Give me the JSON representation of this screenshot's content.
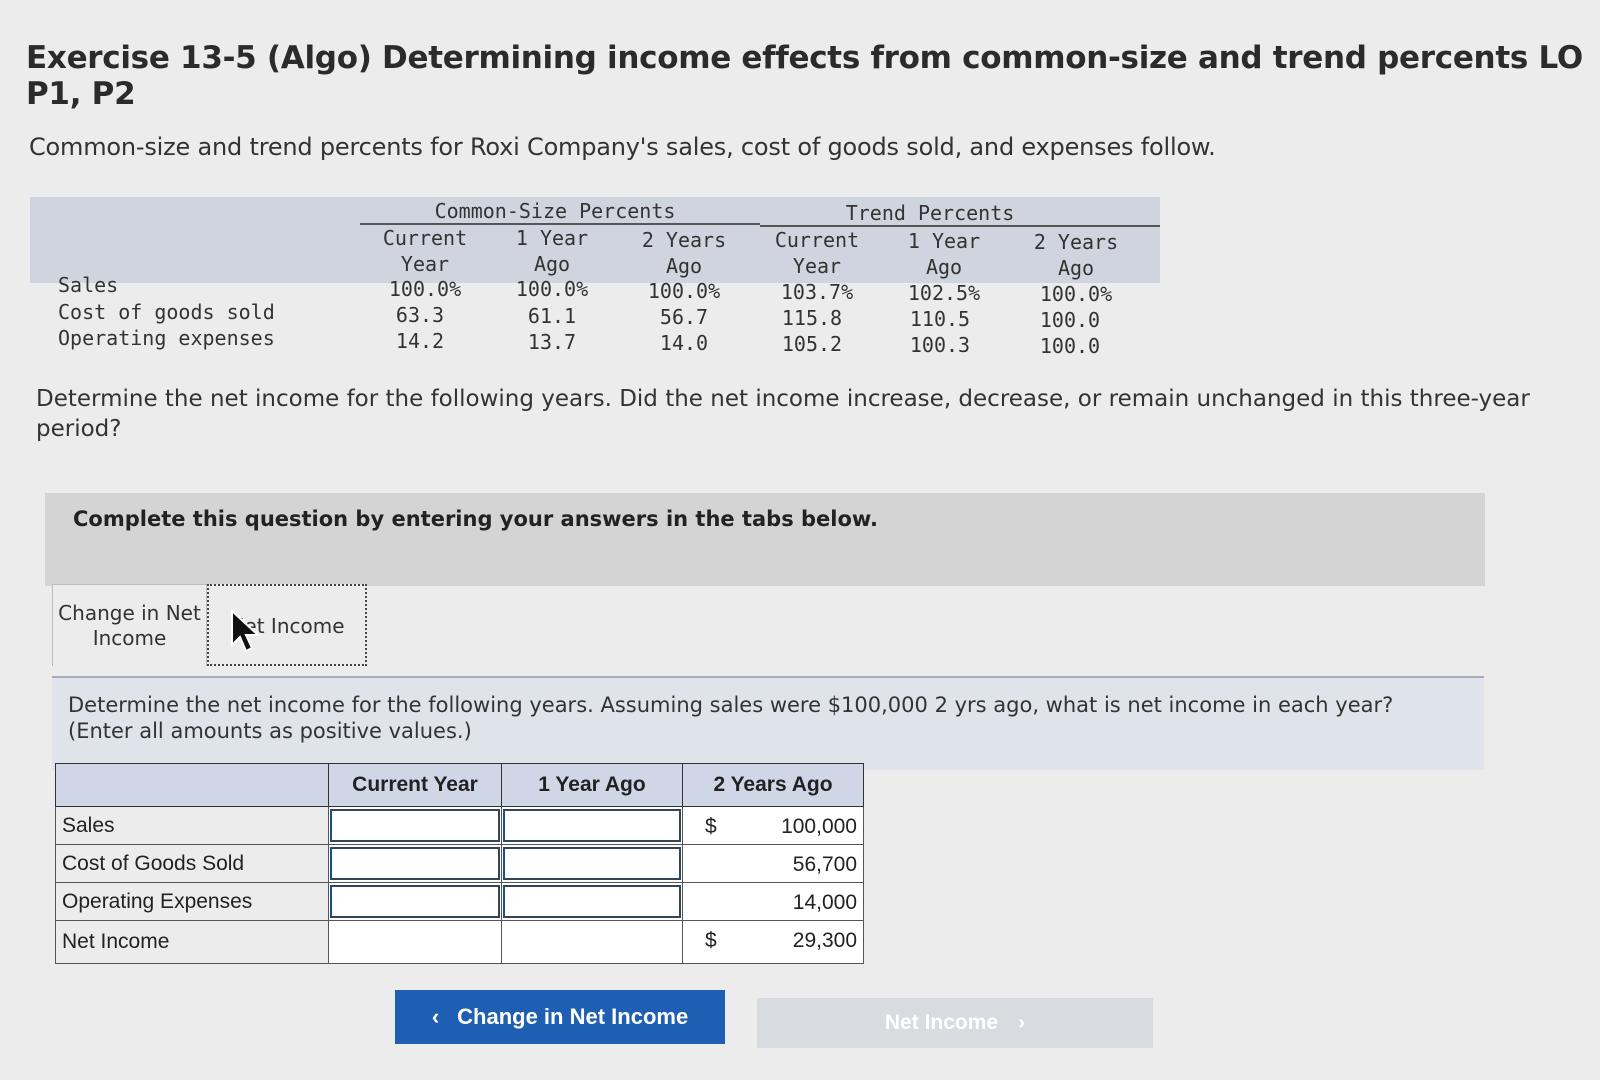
{
  "header": {
    "title": "Exercise 13-5 (Algo) Determining income effects from common-size and trend percents LO P1, P2",
    "intro": "Common-size and trend percents for Roxi Company's sales, cost of goods sold, and expenses follow."
  },
  "percent_table": {
    "group_common": "Common-Size Percents",
    "group_trend": "Trend Percents",
    "columns": [
      {
        "line1": "Current",
        "line2": "Year"
      },
      {
        "line1": "1 Year",
        "line2": "Ago"
      },
      {
        "line1": "2 Years",
        "line2": "Ago"
      },
      {
        "line1": "Current",
        "line2": "Year"
      },
      {
        "line1": "1 Year",
        "line2": "Ago"
      },
      {
        "line1": "2 Years",
        "line2": "Ago"
      }
    ],
    "rows": [
      {
        "label": "Sales",
        "values": [
          "100.0%",
          "100.0%",
          "100.0%",
          "103.7%",
          "102.5%",
          "100.0%"
        ]
      },
      {
        "label": "Cost of goods sold",
        "values": [
          "63.3",
          "61.1",
          "56.7",
          "115.8",
          "110.5",
          "100.0"
        ]
      },
      {
        "label": "Operating expenses",
        "values": [
          "14.2",
          "13.7",
          "14.0",
          "105.2",
          "100.3",
          "100.0"
        ]
      }
    ]
  },
  "question": "Determine the net income for the following years. Did the net income increase, decrease, or remain unchanged in this three-year period?",
  "instructions": "Complete this question by entering your answers in the tabs below.",
  "tabs": [
    {
      "label_line1": "Change in Net",
      "label_line2": "Income"
    },
    {
      "label": "Net Income"
    }
  ],
  "panel": {
    "text": "Determine the net income for the following years. Assuming sales were $100,000 2 yrs ago, what is net income in each year?",
    "note": "(Enter all amounts as positive values.)"
  },
  "answer_table": {
    "headers": [
      "Current Year",
      "1 Year Ago",
      "2 Years Ago"
    ],
    "rows": [
      {
        "label": "Sales",
        "current": "",
        "one_year": "",
        "dollar": "$",
        "two_years": "100,000"
      },
      {
        "label": "Cost of Goods Sold",
        "current": "",
        "one_year": "",
        "dollar": "",
        "two_years": "56,700"
      },
      {
        "label": "Operating Expenses",
        "current": "",
        "one_year": "",
        "dollar": "",
        "two_years": "14,000"
      },
      {
        "label": "Net Income",
        "current": "",
        "one_year": "",
        "dollar": "$",
        "two_years": "29,300"
      }
    ]
  },
  "nav": {
    "prev_label": "Change in Net Income",
    "next_label": "Net Income",
    "prev_icon": "‹",
    "next_icon": "›"
  }
}
